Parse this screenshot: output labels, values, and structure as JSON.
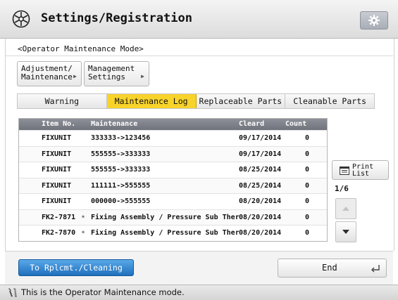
{
  "header": {
    "title": "Settings/Registration",
    "logo_icon": "settings-registration-icon",
    "gear_icon": "gear-icon"
  },
  "mode_title": "<Operator Maintenance Mode>",
  "menu": [
    {
      "line1": "Adjustment/",
      "line2": "Maintenance"
    },
    {
      "line1": "Management",
      "line2": "Settings"
    }
  ],
  "tabs": [
    {
      "label": "Warning",
      "active": false
    },
    {
      "label": "Maintenance Log",
      "active": true
    },
    {
      "label": "Replaceable Parts",
      "active": false
    },
    {
      "label": "Cleanable Parts",
      "active": false
    }
  ],
  "table": {
    "headers": {
      "item": "Item No.",
      "maintenance": "Maintenance",
      "cleard": "Cleard",
      "count": "Count"
    },
    "rows": [
      {
        "item": "FIXUNIT",
        "maintenance": "333333->123456",
        "cleard": "09/17/2014",
        "count": "0",
        "linked": false
      },
      {
        "item": "FIXUNIT",
        "maintenance": "555555->333333",
        "cleard": "09/17/2014",
        "count": "0",
        "linked": false
      },
      {
        "item": "FIXUNIT",
        "maintenance": "555555->333333",
        "cleard": "08/25/2014",
        "count": "0",
        "linked": false
      },
      {
        "item": "FIXUNIT",
        "maintenance": "111111->555555",
        "cleard": "08/25/2014",
        "count": "0",
        "linked": false
      },
      {
        "item": "FIXUNIT",
        "maintenance": "000000->555555",
        "cleard": "08/20/2014",
        "count": "0",
        "linked": false
      },
      {
        "item": "FK2-7871",
        "maintenance": "Fixing Assembly / Pressure Sub Therm",
        "cleard": "08/20/2014",
        "count": "0",
        "linked": true
      },
      {
        "item": "FK2-7870",
        "maintenance": "Fixing Assembly / Pressure Sub Therm",
        "cleard": "08/20/2014",
        "count": "0",
        "linked": true
      }
    ]
  },
  "print_button": {
    "line1": "Print",
    "line2": "List"
  },
  "page_indicator": "1/6",
  "footer": {
    "rplc_button": "To Rplcmt./Cleaning",
    "end_button": "End"
  },
  "status": {
    "text": "This is the Operator Maintenance mode."
  },
  "colors": {
    "active_tab": "#f8d32a",
    "primary_button": "#1f6fbd",
    "table_header": "#7d8088"
  }
}
